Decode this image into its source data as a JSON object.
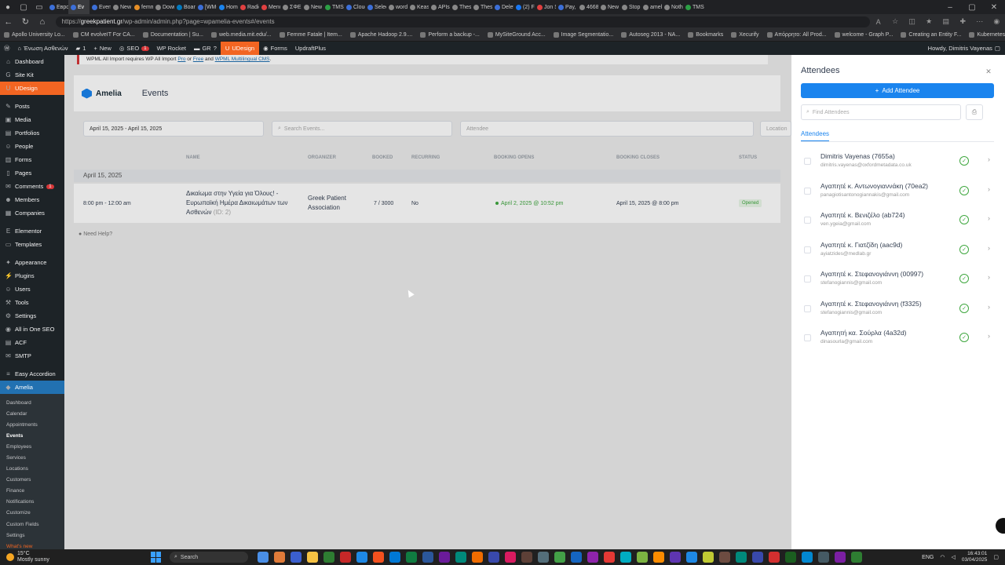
{
  "browser": {
    "tabs": [
      {
        "label": "Европ",
        "color": "#3c6fd8"
      },
      {
        "label": "Ev",
        "color": "#3c6fd8",
        "active": true
      },
      {
        "label": "Events",
        "color": "#3c6fd8"
      },
      {
        "label": "New ta",
        "color": "#888888"
      },
      {
        "label": "femme",
        "color": "#e58e26"
      },
      {
        "label": "Downl",
        "color": "#888888"
      },
      {
        "label": "Board",
        "color": "#0079bf"
      },
      {
        "label": "[WM-1",
        "color": "#3c6fd8"
      },
      {
        "label": "Home",
        "color": "#1a84ee"
      },
      {
        "label": "Radiol",
        "color": "#e04040"
      },
      {
        "label": "Menu",
        "color": "#e04040"
      },
      {
        "label": "ΣΦΕΕ",
        "color": "#888888"
      },
      {
        "label": "New ta",
        "color": "#888888"
      },
      {
        "label": "TMS P",
        "color": "#2c9f45"
      },
      {
        "label": "Cloudc",
        "color": "#3c6fd8"
      },
      {
        "label": "Select",
        "color": "#3c6fd8"
      },
      {
        "label": "wordp",
        "color": "#888888"
      },
      {
        "label": "Keas 4",
        "color": "#888888"
      },
      {
        "label": "APIs &",
        "color": "#888888"
      },
      {
        "label": "Thessa",
        "color": "#888888"
      },
      {
        "label": "Thessa",
        "color": "#888888"
      },
      {
        "label": "Delete",
        "color": "#3c6fd8"
      },
      {
        "label": "(2) Fac",
        "color": "#1877f2"
      },
      {
        "label": "Jon Sti",
        "color": "#e04040"
      },
      {
        "label": "Pay, Sa",
        "color": "#3c6fd8"
      },
      {
        "label": "4668C",
        "color": "#888888"
      },
      {
        "label": "New ta",
        "color": "#888888"
      },
      {
        "label": "Stop W",
        "color": "#888888"
      },
      {
        "label": "amelia",
        "color": "#888888"
      },
      {
        "label": "Nothin",
        "color": "#888888"
      },
      {
        "label": "TMS P",
        "color": "#2c9f45"
      }
    ],
    "url_prefix": "https://",
    "url_host": "greekpatient.gr",
    "url_path": "/wp-admin/admin.php?page=wpamelia-events#/events",
    "bookmarks": [
      "Apollo University Lo...",
      "CM evolveIT For CA...",
      "Documentation | Su...",
      "web.media.mit.edu/...",
      "Femme Fatale | Item...",
      "Apache Hadoop 2.9....",
      "Perform a backup -...",
      "MySiteGround Acc...",
      "Image Segmentatio...",
      "Autoseg 2013 - NA...",
      "Bookmarks",
      "Xecurify",
      "Απόρρητο: All Prod...",
      "welcome - Graph P...",
      "Creating an Entity F...",
      "Kubernetes"
    ],
    "other_favourites": "Other favourites"
  },
  "wpbar": {
    "site": "Ένωση Ασθενών",
    "updates": "1",
    "new": "New",
    "seo": "SEO",
    "seo_badge": "1",
    "rocket": "WP Rocket",
    "gr": "GR",
    "udesign": "UDesign",
    "forms": "Forms",
    "updraft": "UpdraftPlus",
    "howdy": "Howdy, Dimitris Vayenas"
  },
  "sidebar": {
    "items": [
      {
        "label": "Dashboard",
        "icon": "dashboard-icon",
        "glyph": "⌂"
      },
      {
        "label": "Site Kit",
        "icon": "sitekit-icon",
        "glyph": "G"
      },
      {
        "label": "UDesign",
        "icon": "udesign-icon",
        "glyph": "U",
        "hl": true
      },
      {
        "sep": true
      },
      {
        "label": "Posts",
        "icon": "pin-icon",
        "glyph": "✎"
      },
      {
        "label": "Media",
        "icon": "media-icon",
        "glyph": "▣"
      },
      {
        "label": "Portfolios",
        "icon": "portfolio-icon",
        "glyph": "▤"
      },
      {
        "label": "People",
        "icon": "people-icon",
        "glyph": "☺"
      },
      {
        "label": "Forms",
        "icon": "forms-icon",
        "glyph": "▥"
      },
      {
        "label": "Pages",
        "icon": "pages-icon",
        "glyph": "▯"
      },
      {
        "label": "Comments",
        "icon": "comments-icon",
        "glyph": "✉",
        "badge": "1"
      },
      {
        "label": "Members",
        "icon": "members-icon",
        "glyph": "☻"
      },
      {
        "label": "Companies",
        "icon": "companies-icon",
        "glyph": "▦"
      },
      {
        "sep": true
      },
      {
        "label": "Elementor",
        "icon": "elementor-icon",
        "glyph": "E"
      },
      {
        "label": "Templates",
        "icon": "templates-icon",
        "glyph": "▭"
      },
      {
        "sep": true
      },
      {
        "label": "Appearance",
        "icon": "appearance-icon",
        "glyph": "✦"
      },
      {
        "label": "Plugins",
        "icon": "plugins-icon",
        "glyph": "⚡"
      },
      {
        "label": "Users",
        "icon": "users-icon",
        "glyph": "☺"
      },
      {
        "label": "Tools",
        "icon": "tools-icon",
        "glyph": "⚒"
      },
      {
        "label": "Settings",
        "icon": "settings-icon",
        "glyph": "⚙"
      },
      {
        "label": "All in One SEO",
        "icon": "aioseo-icon",
        "glyph": "◉"
      },
      {
        "label": "ACF",
        "icon": "acf-icon",
        "glyph": "▤"
      },
      {
        "label": "SMTP",
        "icon": "smtp-icon",
        "glyph": "✉"
      },
      {
        "sep": true
      },
      {
        "label": "Easy Accordion",
        "icon": "accordion-icon",
        "glyph": "≡"
      },
      {
        "label": "Amelia",
        "icon": "amelia-icon",
        "glyph": "◆",
        "cur": true
      }
    ],
    "submenu": [
      "Dashboard",
      "Calendar",
      "Appointments",
      "Events",
      "Employees",
      "Services",
      "Locations",
      "Customers",
      "Finance",
      "Notifications",
      "Customize",
      "Custom Fields",
      "Settings",
      "What's new"
    ],
    "submenu_active": "Events",
    "submenu_new": "What's new"
  },
  "main": {
    "notice_a": "WPML All Import requires WP All Import ",
    "notice_pro": "Pro",
    "notice_or": " or ",
    "notice_free": "Free",
    "notice_and": " and ",
    "notice_wpml": "WPML Multilingual CMS",
    "notice_end": ".",
    "brand": "Amelia",
    "title": "Events",
    "filters": {
      "date": "April 15, 2025 - April 15, 2025",
      "search_placeholder": "Search Events...",
      "attendee_placeholder": "Attendee",
      "location_placeholder": "Location"
    },
    "columns": [
      "Name",
      "Organizer",
      "Booked",
      "Recurring",
      "Booking Opens",
      "Booking Closes",
      "Status"
    ],
    "date_group": "April 15, 2025",
    "event": {
      "time": "8:00 pm - 12:00 am",
      "name": "Δικαίωμα στην Υγεία για Όλους! - Ευρωπαϊκή Ημέρα Δικαιωμάτων των Ασθενών",
      "id": "(ID: 2)",
      "organizer": "Greek Patient Association",
      "booked": "7 / 3000",
      "recurring": "No",
      "opens": "April 2, 2025 @ 10:52 pm",
      "closes": "April 15, 2025 @ 8:00 pm",
      "status": "Opened"
    },
    "help": "Need Help?"
  },
  "drawer": {
    "title": "Attendees",
    "add": "Add Attendee",
    "find_placeholder": "Find Attendees",
    "tab": "Attendees",
    "attendees": [
      {
        "name": "Dimitris Vayenas (7655a)",
        "email": "dimitris.vayenas@oxfordmetadata.co.uk"
      },
      {
        "name": "Αγαπητέ κ. Αντωνογιαννάκη (70ea2)",
        "email": "panagiotisantonogiannakis@gmail.com"
      },
      {
        "name": "Αγαπητέ κ. Βενιζέλο (ab724)",
        "email": "ven.ygeia@gmail.com"
      },
      {
        "name": "Αγαπητέ κ. Γιατζίδη (aac9d)",
        "email": "ayiatzides@medlab.gr"
      },
      {
        "name": "Αγαπητέ κ. Στεφανογιάννη (00997)",
        "email": "stefanogiannis@gmail.com"
      },
      {
        "name": "Αγαπητέ κ. Στεφανογιάννη (f3325)",
        "email": "stefanogiannis@gmail.com"
      },
      {
        "name": "Αγαπητή κα. Σούρλα (4a32d)",
        "email": "dinasourla@gmail.com"
      }
    ]
  },
  "taskbar": {
    "temp": "15°C",
    "weather": "Mostly sunny",
    "search": "Search",
    "lang": "ENG",
    "time": "16:43:01",
    "date": "03/04/2025",
    "app_colors": [
      "#4a8fe7",
      "#e07b39",
      "#3b5fce",
      "#f6c243",
      "#2e7d32",
      "#c62828",
      "#1e88e5",
      "#f4511e",
      "#0078d4",
      "#107c41",
      "#2b579a",
      "#6a1b9a",
      "#00897b",
      "#ef6c00",
      "#3949ab",
      "#d81b60",
      "#5d4037",
      "#546e7a",
      "#43a047",
      "#1565c0",
      "#8e24aa",
      "#e53935",
      "#00acc1",
      "#7cb342",
      "#fb8c00",
      "#5e35b1",
      "#1e88e5",
      "#c0ca33",
      "#6d4c41",
      "#00897b",
      "#3949ab",
      "#d32f2f",
      "#1b5e20",
      "#0288d1",
      "#455a64",
      "#7b1fa2",
      "#2e7d32"
    ]
  }
}
